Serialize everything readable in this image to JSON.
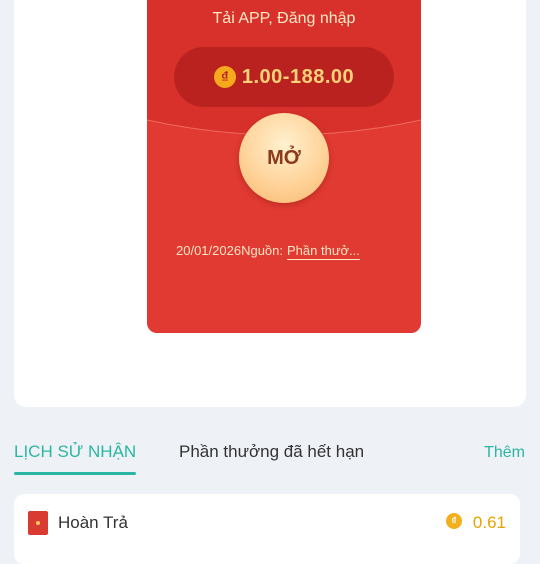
{
  "envelope": {
    "title": "Tải APP, Đăng nhập",
    "currency_symbol": "₫",
    "amount_range": "1.00-188.00",
    "open_label": "MỞ",
    "date": "20/01/2026",
    "source_label": "Nguồn:",
    "source_value": "Phần thưở..."
  },
  "tabs": {
    "history_label": "LỊCH SỬ NHẬN",
    "expired_label": "Phần thưởng đã hết hạn",
    "more_label": "Thêm"
  },
  "history": [
    {
      "label": "Hoàn Trả",
      "coin_icon": "coin-icon",
      "value": "0.61"
    }
  ],
  "colors": {
    "envelope_red": "#e03a32",
    "accent_teal": "#2bb6a3",
    "gold": "#e7a400"
  }
}
